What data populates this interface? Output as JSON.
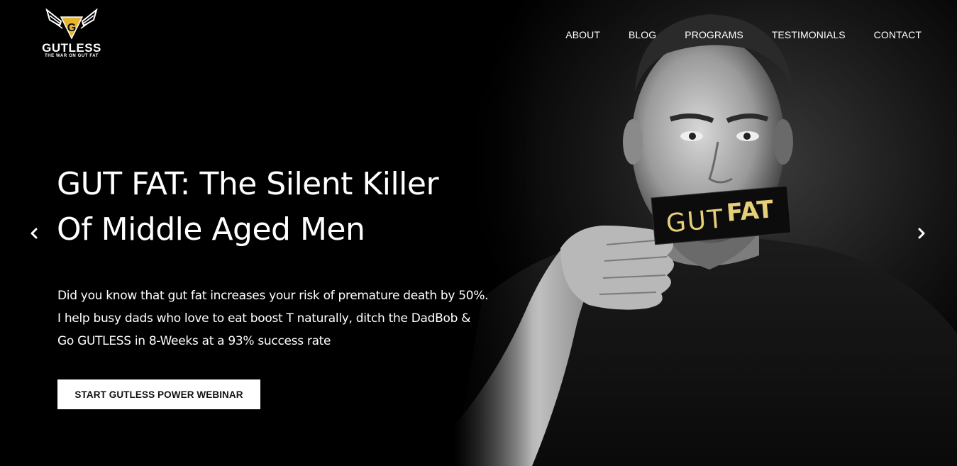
{
  "brand": {
    "name": "GUTLESS",
    "tagline": "THE WAR ON GUT FAT",
    "logo_letter": "G",
    "accent_color": "#E8B530"
  },
  "nav": {
    "items": [
      {
        "label": "ABOUT"
      },
      {
        "label": "BLOG"
      },
      {
        "label": "PROGRAMS"
      },
      {
        "label": "TESTIMONIALS"
      },
      {
        "label": "CONTACT"
      }
    ]
  },
  "hero": {
    "headline_lines": [
      "GUT FAT: The Silent Killer",
      "Of Middle Aged Men"
    ],
    "description_lines": [
      "Did you know that gut fat increases your risk of premature death by 50%.",
      "I help busy dads who love to eat boost T naturally, ditch the DadBob &",
      "Go GUTLESS in 8-Weeks at a 93% success rate"
    ],
    "cta_label": "START GUTLESS POWER WEBINAR",
    "photo_sign_text_1": "GUT",
    "photo_sign_text_2": "FAT"
  },
  "carousel": {
    "prev_icon": "chevron-left-icon",
    "next_icon": "chevron-right-icon"
  }
}
